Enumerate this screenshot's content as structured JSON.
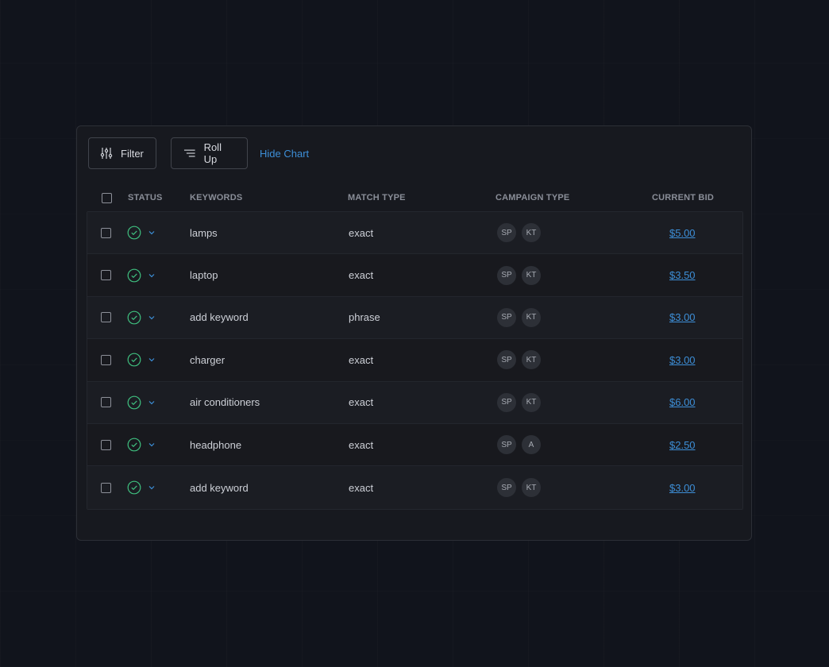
{
  "toolbar": {
    "filter_label": "Filter",
    "rollup_label": "Roll Up",
    "hide_chart_label": "Hide Chart"
  },
  "columns": {
    "status": "STATUS",
    "keywords": "KEYWORDS",
    "match_type": "MATCH TYPE",
    "campaign_type": "CAMPAIGN TYPE",
    "current_bid": "CURRENT BID"
  },
  "rows": [
    {
      "keyword": "lamps",
      "match_type": "exact",
      "campaign": [
        "SP",
        "KT"
      ],
      "bid": "$5.00"
    },
    {
      "keyword": "laptop",
      "match_type": "exact",
      "campaign": [
        "SP",
        "KT"
      ],
      "bid": "$3.50"
    },
    {
      "keyword": "add keyword",
      "match_type": "phrase",
      "campaign": [
        "SP",
        "KT"
      ],
      "bid": "$3.00"
    },
    {
      "keyword": "charger",
      "match_type": "exact",
      "campaign": [
        "SP",
        "KT"
      ],
      "bid": "$3.00"
    },
    {
      "keyword": "air conditioners",
      "match_type": "exact",
      "campaign": [
        "SP",
        "KT"
      ],
      "bid": "$6.00"
    },
    {
      "keyword": "headphone",
      "match_type": "exact",
      "campaign": [
        "SP",
        "A"
      ],
      "bid": "$2.50"
    },
    {
      "keyword": "add keyword",
      "match_type": "exact",
      "campaign": [
        "SP",
        "KT"
      ],
      "bid": "$3.00"
    }
  ],
  "colors": {
    "accent": "#3d8fd8",
    "status_ok": "#3fbf7f",
    "panel_bg": "#17191f"
  },
  "icons": {
    "filter": "sliders-icon",
    "rollup": "list-icon",
    "status": "check-circle-icon",
    "expand": "chevron-down-icon"
  }
}
